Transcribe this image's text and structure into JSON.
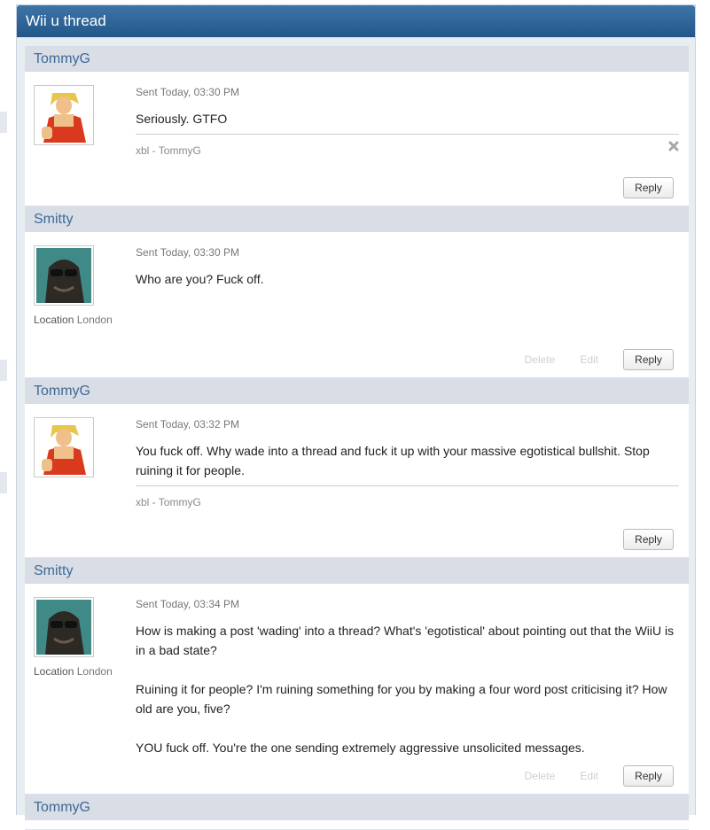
{
  "window": {
    "title": "Wii u thread"
  },
  "messages": [
    {
      "author": "TommyG",
      "avatar": "ken-avatar",
      "sent": "Sent Today, 03:30 PM",
      "paragraphs": [
        "Seriously. GTFO"
      ],
      "signature": "xbl - TommyG",
      "has_close": true,
      "actions": {
        "reply": "Reply"
      }
    },
    {
      "author": "Smitty",
      "avatar": "sunglasses-avatar",
      "location_label": "Location",
      "location_value": "London",
      "sent": "Sent Today, 03:30 PM",
      "paragraphs": [
        "Who are you? Fuck off."
      ],
      "actions": {
        "delete": "Delete",
        "edit": "Edit",
        "reply": "Reply"
      }
    },
    {
      "author": "TommyG",
      "avatar": "ken-avatar",
      "sent": "Sent Today, 03:32 PM",
      "paragraphs": [
        "You fuck off. Why wade into a thread and fuck it up with your massive egotistical bullshit. Stop ruining it for people."
      ],
      "signature": "xbl - TommyG",
      "actions": {
        "reply": "Reply"
      }
    },
    {
      "author": "Smitty",
      "avatar": "sunglasses-avatar",
      "location_label": "Location",
      "location_value": "London",
      "sent": "Sent Today, 03:34 PM",
      "paragraphs": [
        "How is making a post 'wading' into a thread? What's 'egotistical' about pointing out that the WiiU is in a bad state?",
        "Ruining it for people? I'm ruining something for you by making a four word post criticising it? How old are you, five?",
        "YOU fuck off. You're the one sending extremely aggressive unsolicited messages."
      ],
      "actions": {
        "delete": "Delete",
        "edit": "Edit",
        "reply": "Reply"
      }
    },
    {
      "author": "TommyG"
    }
  ]
}
